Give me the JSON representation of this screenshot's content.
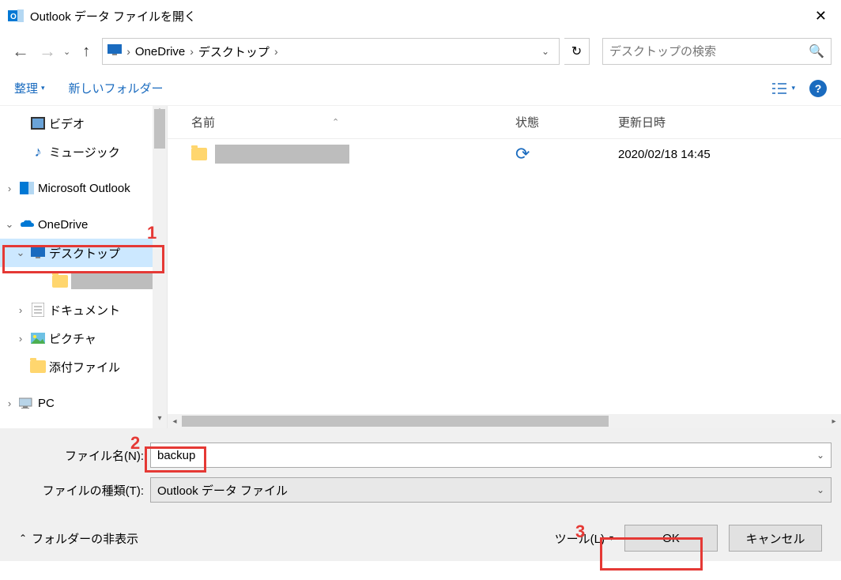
{
  "title": "Outlook データ ファイルを開く",
  "breadcrumb": {
    "p1": "OneDrive",
    "p2": "デスクトップ"
  },
  "search": {
    "placeholder": "デスクトップの検索"
  },
  "toolbar": {
    "organize": "整理",
    "newfolder": "新しいフォルダー"
  },
  "columns": {
    "name": "名前",
    "status": "状態",
    "date": "更新日時"
  },
  "file": {
    "date": "2020/02/18 14:45"
  },
  "tree": {
    "video": "ビデオ",
    "music": "ミュージック",
    "outlook": "Microsoft Outlook",
    "onedrive": "OneDrive",
    "desktop": "デスクトップ",
    "documents": "ドキュメント",
    "pictures": "ピクチャ",
    "attach": "添付ファイル",
    "pc": "PC"
  },
  "form": {
    "filename_label": "ファイル名(N):",
    "filename_value": "backup",
    "filetype_label": "ファイルの種類(T):",
    "filetype_value": "Outlook データ ファイル"
  },
  "footer": {
    "folder_hide": "フォルダーの非表示",
    "tools": "ツール(L)",
    "ok": "OK",
    "cancel": "キャンセル"
  },
  "annot": {
    "n1": "1",
    "n2": "2",
    "n3": "3"
  }
}
